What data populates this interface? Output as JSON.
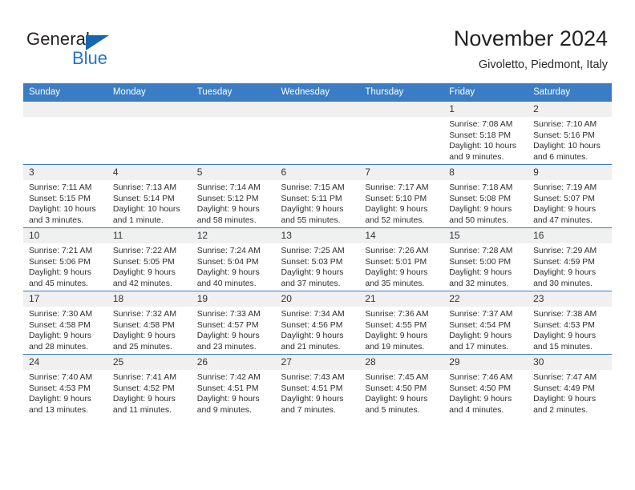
{
  "brand": {
    "name_dark": "General",
    "name_light": "Blue",
    "color_dark": "#231f20",
    "color_blue": "#1f76c4"
  },
  "header": {
    "month_title": "November 2024",
    "location": "Givoletto, Piedmont, Italy"
  },
  "theme": {
    "header_row_bg": "#3b7dc4",
    "daynum_bg": "#f0f0f0",
    "grid_line": "#3b7dc4",
    "text": "#2e2e2e"
  },
  "weekday_headers": [
    "Sunday",
    "Monday",
    "Tuesday",
    "Wednesday",
    "Thursday",
    "Friday",
    "Saturday"
  ],
  "labels": {
    "sunrise": "Sunrise:",
    "sunset": "Sunset:",
    "daylight": "Daylight:"
  },
  "weeks": [
    [
      {
        "day": "",
        "empty": true
      },
      {
        "day": "",
        "empty": true
      },
      {
        "day": "",
        "empty": true
      },
      {
        "day": "",
        "empty": true
      },
      {
        "day": "",
        "empty": true
      },
      {
        "day": "1",
        "sunrise": "Sunrise: 7:08 AM",
        "sunset": "Sunset: 5:18 PM",
        "daylight_1": "Daylight: 10 hours",
        "daylight_2": "and 9 minutes."
      },
      {
        "day": "2",
        "sunrise": "Sunrise: 7:10 AM",
        "sunset": "Sunset: 5:16 PM",
        "daylight_1": "Daylight: 10 hours",
        "daylight_2": "and 6 minutes."
      }
    ],
    [
      {
        "day": "3",
        "sunrise": "Sunrise: 7:11 AM",
        "sunset": "Sunset: 5:15 PM",
        "daylight_1": "Daylight: 10 hours",
        "daylight_2": "and 3 minutes."
      },
      {
        "day": "4",
        "sunrise": "Sunrise: 7:13 AM",
        "sunset": "Sunset: 5:14 PM",
        "daylight_1": "Daylight: 10 hours",
        "daylight_2": "and 1 minute."
      },
      {
        "day": "5",
        "sunrise": "Sunrise: 7:14 AM",
        "sunset": "Sunset: 5:12 PM",
        "daylight_1": "Daylight: 9 hours",
        "daylight_2": "and 58 minutes."
      },
      {
        "day": "6",
        "sunrise": "Sunrise: 7:15 AM",
        "sunset": "Sunset: 5:11 PM",
        "daylight_1": "Daylight: 9 hours",
        "daylight_2": "and 55 minutes."
      },
      {
        "day": "7",
        "sunrise": "Sunrise: 7:17 AM",
        "sunset": "Sunset: 5:10 PM",
        "daylight_1": "Daylight: 9 hours",
        "daylight_2": "and 52 minutes."
      },
      {
        "day": "8",
        "sunrise": "Sunrise: 7:18 AM",
        "sunset": "Sunset: 5:08 PM",
        "daylight_1": "Daylight: 9 hours",
        "daylight_2": "and 50 minutes."
      },
      {
        "day": "9",
        "sunrise": "Sunrise: 7:19 AM",
        "sunset": "Sunset: 5:07 PM",
        "daylight_1": "Daylight: 9 hours",
        "daylight_2": "and 47 minutes."
      }
    ],
    [
      {
        "day": "10",
        "sunrise": "Sunrise: 7:21 AM",
        "sunset": "Sunset: 5:06 PM",
        "daylight_1": "Daylight: 9 hours",
        "daylight_2": "and 45 minutes."
      },
      {
        "day": "11",
        "sunrise": "Sunrise: 7:22 AM",
        "sunset": "Sunset: 5:05 PM",
        "daylight_1": "Daylight: 9 hours",
        "daylight_2": "and 42 minutes."
      },
      {
        "day": "12",
        "sunrise": "Sunrise: 7:24 AM",
        "sunset": "Sunset: 5:04 PM",
        "daylight_1": "Daylight: 9 hours",
        "daylight_2": "and 40 minutes."
      },
      {
        "day": "13",
        "sunrise": "Sunrise: 7:25 AM",
        "sunset": "Sunset: 5:03 PM",
        "daylight_1": "Daylight: 9 hours",
        "daylight_2": "and 37 minutes."
      },
      {
        "day": "14",
        "sunrise": "Sunrise: 7:26 AM",
        "sunset": "Sunset: 5:01 PM",
        "daylight_1": "Daylight: 9 hours",
        "daylight_2": "and 35 minutes."
      },
      {
        "day": "15",
        "sunrise": "Sunrise: 7:28 AM",
        "sunset": "Sunset: 5:00 PM",
        "daylight_1": "Daylight: 9 hours",
        "daylight_2": "and 32 minutes."
      },
      {
        "day": "16",
        "sunrise": "Sunrise: 7:29 AM",
        "sunset": "Sunset: 4:59 PM",
        "daylight_1": "Daylight: 9 hours",
        "daylight_2": "and 30 minutes."
      }
    ],
    [
      {
        "day": "17",
        "sunrise": "Sunrise: 7:30 AM",
        "sunset": "Sunset: 4:58 PM",
        "daylight_1": "Daylight: 9 hours",
        "daylight_2": "and 28 minutes."
      },
      {
        "day": "18",
        "sunrise": "Sunrise: 7:32 AM",
        "sunset": "Sunset: 4:58 PM",
        "daylight_1": "Daylight: 9 hours",
        "daylight_2": "and 25 minutes."
      },
      {
        "day": "19",
        "sunrise": "Sunrise: 7:33 AM",
        "sunset": "Sunset: 4:57 PM",
        "daylight_1": "Daylight: 9 hours",
        "daylight_2": "and 23 minutes."
      },
      {
        "day": "20",
        "sunrise": "Sunrise: 7:34 AM",
        "sunset": "Sunset: 4:56 PM",
        "daylight_1": "Daylight: 9 hours",
        "daylight_2": "and 21 minutes."
      },
      {
        "day": "21",
        "sunrise": "Sunrise: 7:36 AM",
        "sunset": "Sunset: 4:55 PM",
        "daylight_1": "Daylight: 9 hours",
        "daylight_2": "and 19 minutes."
      },
      {
        "day": "22",
        "sunrise": "Sunrise: 7:37 AM",
        "sunset": "Sunset: 4:54 PM",
        "daylight_1": "Daylight: 9 hours",
        "daylight_2": "and 17 minutes."
      },
      {
        "day": "23",
        "sunrise": "Sunrise: 7:38 AM",
        "sunset": "Sunset: 4:53 PM",
        "daylight_1": "Daylight: 9 hours",
        "daylight_2": "and 15 minutes."
      }
    ],
    [
      {
        "day": "24",
        "sunrise": "Sunrise: 7:40 AM",
        "sunset": "Sunset: 4:53 PM",
        "daylight_1": "Daylight: 9 hours",
        "daylight_2": "and 13 minutes."
      },
      {
        "day": "25",
        "sunrise": "Sunrise: 7:41 AM",
        "sunset": "Sunset: 4:52 PM",
        "daylight_1": "Daylight: 9 hours",
        "daylight_2": "and 11 minutes."
      },
      {
        "day": "26",
        "sunrise": "Sunrise: 7:42 AM",
        "sunset": "Sunset: 4:51 PM",
        "daylight_1": "Daylight: 9 hours",
        "daylight_2": "and 9 minutes."
      },
      {
        "day": "27",
        "sunrise": "Sunrise: 7:43 AM",
        "sunset": "Sunset: 4:51 PM",
        "daylight_1": "Daylight: 9 hours",
        "daylight_2": "and 7 minutes."
      },
      {
        "day": "28",
        "sunrise": "Sunrise: 7:45 AM",
        "sunset": "Sunset: 4:50 PM",
        "daylight_1": "Daylight: 9 hours",
        "daylight_2": "and 5 minutes."
      },
      {
        "day": "29",
        "sunrise": "Sunrise: 7:46 AM",
        "sunset": "Sunset: 4:50 PM",
        "daylight_1": "Daylight: 9 hours",
        "daylight_2": "and 4 minutes."
      },
      {
        "day": "30",
        "sunrise": "Sunrise: 7:47 AM",
        "sunset": "Sunset: 4:49 PM",
        "daylight_1": "Daylight: 9 hours",
        "daylight_2": "and 2 minutes."
      }
    ]
  ]
}
